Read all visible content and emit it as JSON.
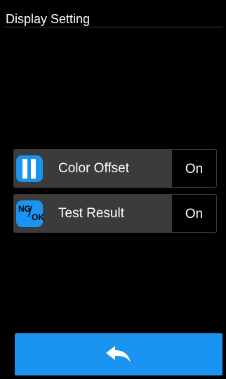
{
  "header": {
    "title": "Display Setting"
  },
  "settings": [
    {
      "icon": "color-offset-icon",
      "label": "Color Offset",
      "value": "On"
    },
    {
      "icon": "ng-ok-icon",
      "icon_text": {
        "ng": "NG",
        "ok": "OK"
      },
      "label": "Test Result",
      "value": "On"
    }
  ],
  "footer": {
    "back_icon": "back-arrow-icon"
  },
  "colors": {
    "background": "#000000",
    "row_background": "#3b3b3b",
    "accent": "#1a94f0",
    "text": "#ffffff"
  }
}
